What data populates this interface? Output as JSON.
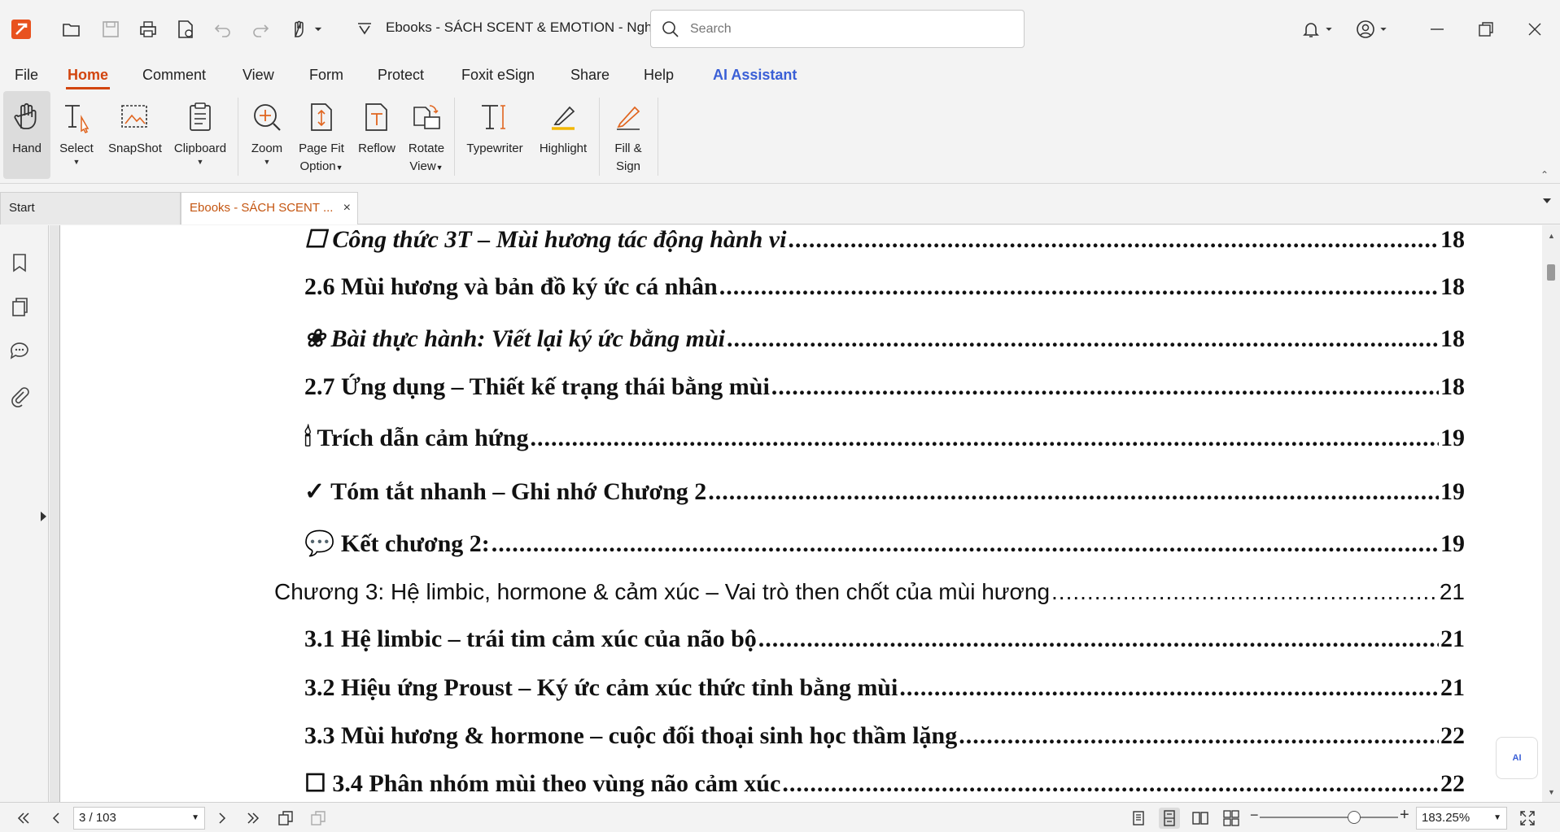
{
  "titlebar": {
    "document_title": "Ebooks - SÁCH SCENT & EMOTION - Nghệ ...",
    "search_placeholder": "Search"
  },
  "menu": [
    "File",
    "Home",
    "Comment",
    "View",
    "Form",
    "Protect",
    "Foxit eSign",
    "Share",
    "Help",
    "AI Assistant"
  ],
  "ribbon": {
    "hand": "Hand",
    "select": "Select",
    "snapshot": "SnapShot",
    "clipboard": "Clipboard",
    "zoom": "Zoom",
    "page_fit_1": "Page Fit",
    "page_fit_2": "Option",
    "reflow": "Reflow",
    "rotate_1": "Rotate",
    "rotate_2": "View",
    "typewriter": "Typewriter",
    "highlight": "Highlight",
    "fill_1": "Fill &",
    "fill_2": "Sign"
  },
  "tabs": {
    "start": "Start",
    "doc": "Ebooks - SÁCH SCENT ...",
    "close": "×"
  },
  "toc": [
    {
      "text": "☐ Công thức 3T – Mùi hương tác động hành vi",
      "page": "18"
    },
    {
      "text": "2.6 Mùi hương và bản đồ ký ức cá nhân",
      "page": "18"
    },
    {
      "text": "❀ Bài thực hành: Viết lại ký ức bằng mùi",
      "page": "18"
    },
    {
      "text": "2.7 Ứng dụng – Thiết kế trạng thái bằng mùi",
      "page": "18"
    },
    {
      "text": "🕯 Trích dẫn cảm hứng",
      "page": "19"
    },
    {
      "text": "✓ Tóm tắt nhanh – Ghi nhớ Chương 2",
      "page": "19"
    },
    {
      "text": "💬 Kết chương 2:",
      "page": "19"
    },
    {
      "text": "Chương 3: Hệ limbic, hormone & cảm xúc – Vai trò then chốt của mùi hương",
      "page": "21"
    },
    {
      "text": "3.1 Hệ limbic – trái tim cảm xúc của não bộ",
      "page": "21"
    },
    {
      "text": "3.2 Hiệu ứng Proust – Ký ức cảm xúc thức tỉnh bằng mùi",
      "page": "21"
    },
    {
      "text": "3.3 Mùi hương & hormone – cuộc đối thoại sinh học thầm lặng",
      "page": "22"
    },
    {
      "text": "☐ 3.4 Phân nhóm mùi theo vùng não cảm xúc",
      "page": "22"
    }
  ],
  "status": {
    "page_indicator": "3 / 103",
    "zoom_level": "183.25%"
  },
  "ai_badge": "AI",
  "colors": {
    "accent": "#d2450f",
    "ai_blue": "#3a5fd6"
  }
}
